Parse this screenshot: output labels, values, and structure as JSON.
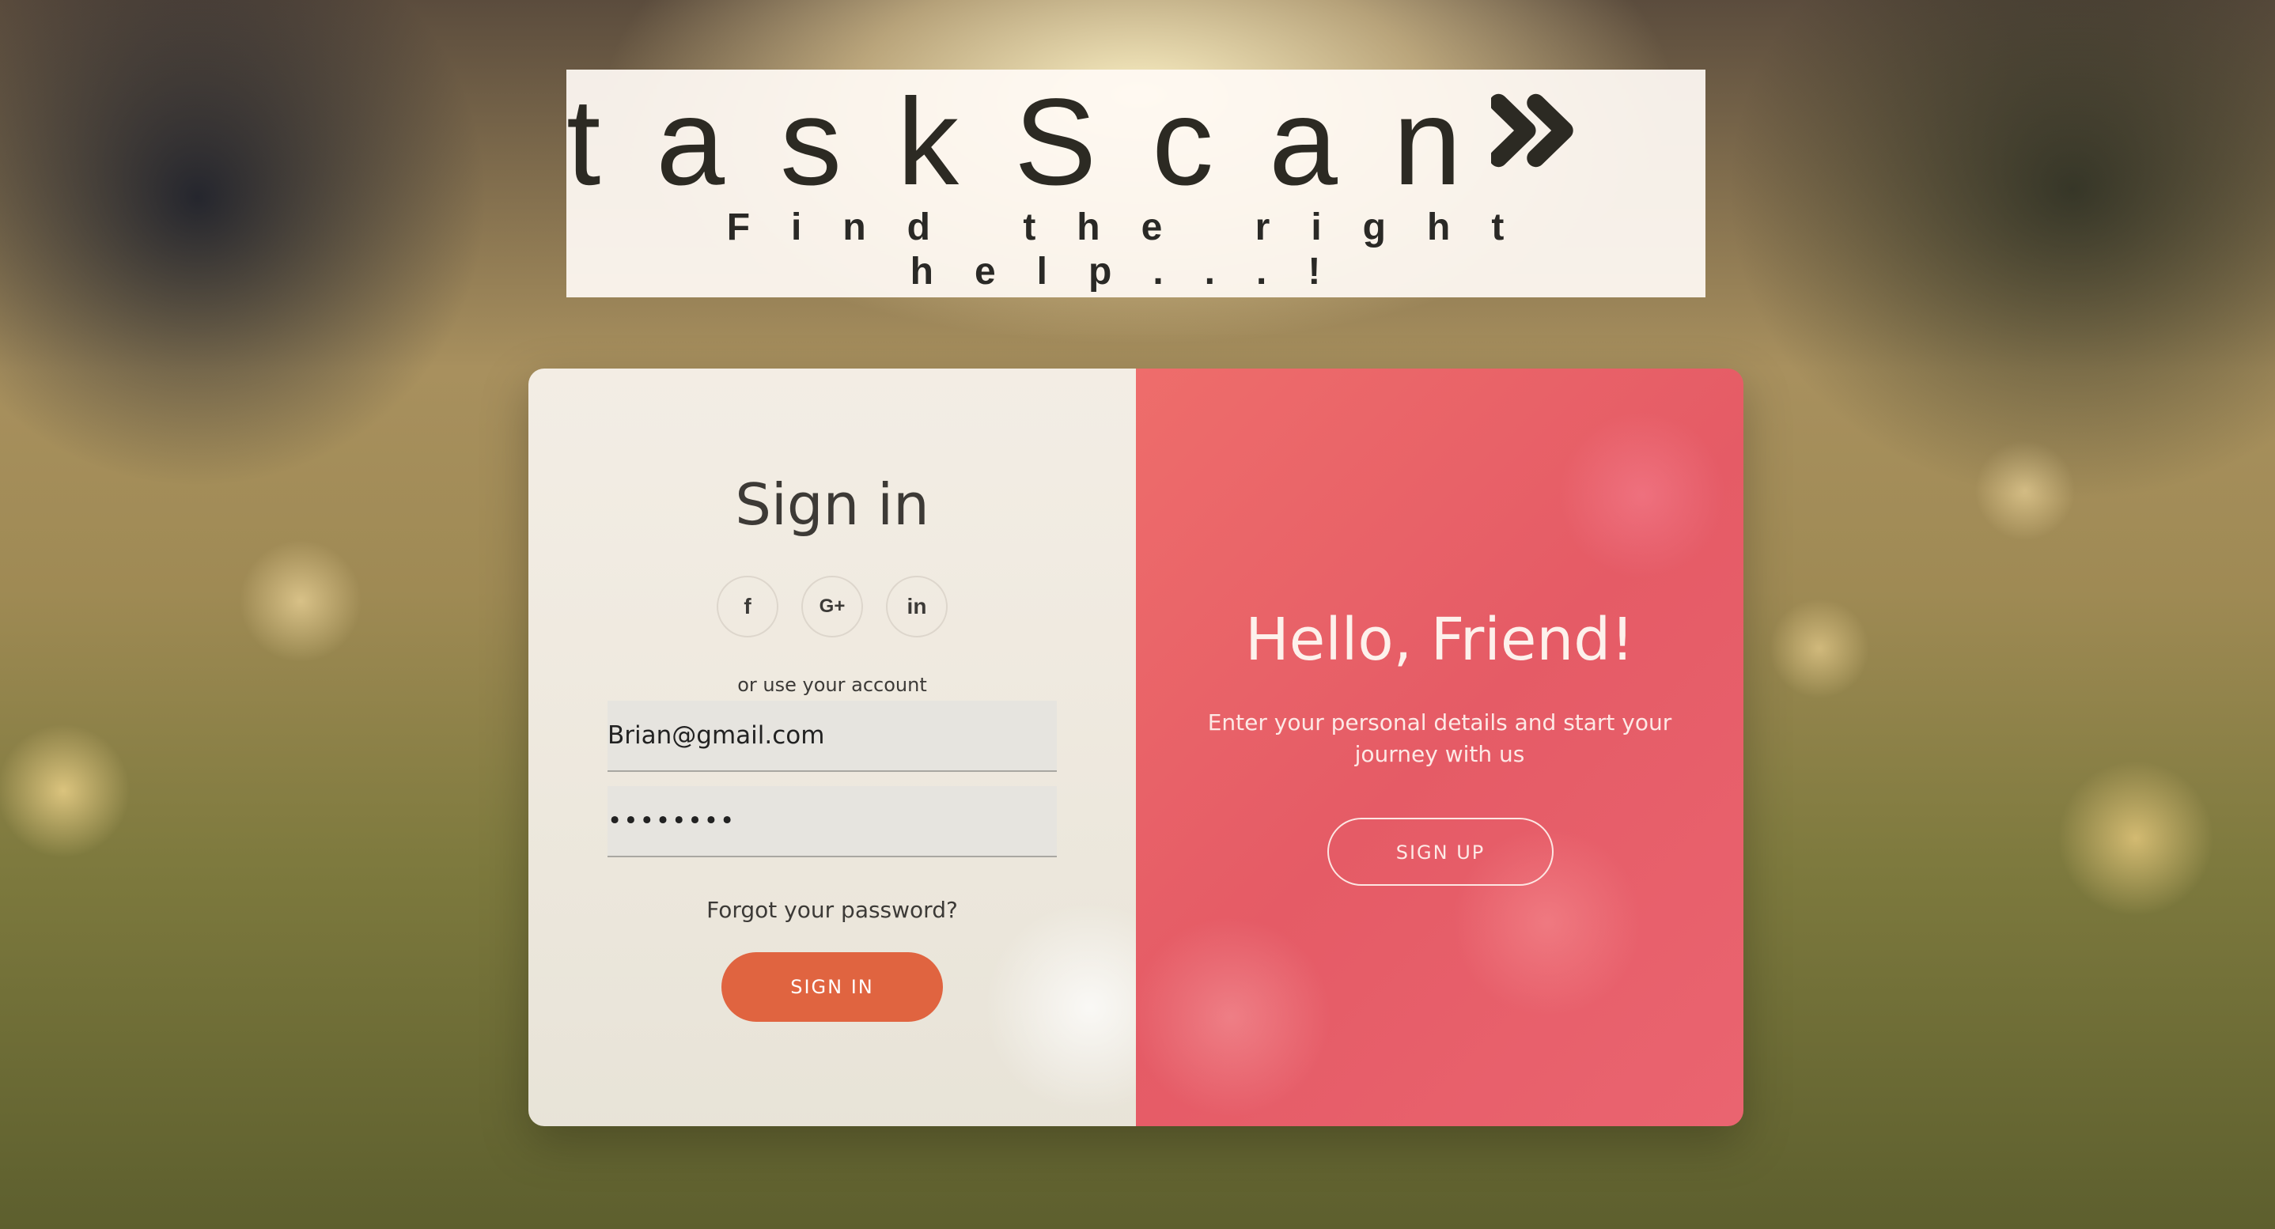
{
  "brand": {
    "name": "taskScan",
    "tagline": "Find the right help...!"
  },
  "signin": {
    "title": "Sign in",
    "socials": [
      {
        "label": "f",
        "icon": "facebook-icon"
      },
      {
        "label": "G+",
        "icon": "google-plus-icon"
      },
      {
        "label": "in",
        "icon": "linkedin-icon"
      }
    ],
    "alt_label": "or use your account",
    "email_value": "Brian@gmail.com",
    "password_value": "••••••••",
    "forgot_label": "Forgot your password?",
    "submit_label": "SIGN IN"
  },
  "welcome": {
    "title": "Hello, Friend!",
    "message": "Enter your personal details and start your journey with us",
    "signup_label": "SIGN UP"
  },
  "colors": {
    "accent_orange": "#e06440",
    "panel_red": "#e55b66"
  }
}
